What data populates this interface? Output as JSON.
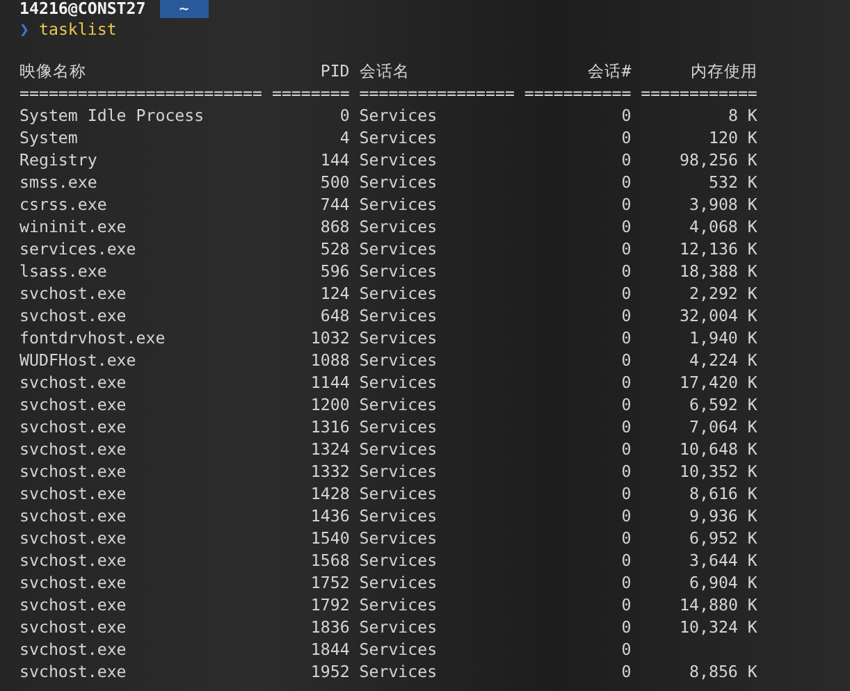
{
  "prompt": {
    "user_host": "14216@CONST27",
    "path": "~",
    "symbol": "❯",
    "command": "tasklist"
  },
  "table": {
    "columns": [
      "映像名称",
      "PID",
      "会话名",
      "会话#",
      "内存使用"
    ],
    "separators": [
      "=========================",
      "========",
      "================",
      "===========",
      "============"
    ],
    "rows": [
      [
        "System Idle Process",
        "0",
        "Services",
        "0",
        "8 K"
      ],
      [
        "System",
        "4",
        "Services",
        "0",
        "120 K"
      ],
      [
        "Registry",
        "144",
        "Services",
        "0",
        "98,256 K"
      ],
      [
        "smss.exe",
        "500",
        "Services",
        "0",
        "532 K"
      ],
      [
        "csrss.exe",
        "744",
        "Services",
        "0",
        "3,908 K"
      ],
      [
        "wininit.exe",
        "868",
        "Services",
        "0",
        "4,068 K"
      ],
      [
        "services.exe",
        "528",
        "Services",
        "0",
        "12,136 K"
      ],
      [
        "lsass.exe",
        "596",
        "Services",
        "0",
        "18,388 K"
      ],
      [
        "svchost.exe",
        "124",
        "Services",
        "0",
        "2,292 K"
      ],
      [
        "svchost.exe",
        "648",
        "Services",
        "0",
        "32,004 K"
      ],
      [
        "fontdrvhost.exe",
        "1032",
        "Services",
        "0",
        "1,940 K"
      ],
      [
        "WUDFHost.exe",
        "1088",
        "Services",
        "0",
        "4,224 K"
      ],
      [
        "svchost.exe",
        "1144",
        "Services",
        "0",
        "17,420 K"
      ],
      [
        "svchost.exe",
        "1200",
        "Services",
        "0",
        "6,592 K"
      ],
      [
        "svchost.exe",
        "1316",
        "Services",
        "0",
        "7,064 K"
      ],
      [
        "svchost.exe",
        "1324",
        "Services",
        "0",
        "10,648 K"
      ],
      [
        "svchost.exe",
        "1332",
        "Services",
        "0",
        "10,352 K"
      ],
      [
        "svchost.exe",
        "1428",
        "Services",
        "0",
        "8,616 K"
      ],
      [
        "svchost.exe",
        "1436",
        "Services",
        "0",
        "9,936 K"
      ],
      [
        "svchost.exe",
        "1540",
        "Services",
        "0",
        "6,952 K"
      ],
      [
        "svchost.exe",
        "1568",
        "Services",
        "0",
        "3,644 K"
      ],
      [
        "svchost.exe",
        "1752",
        "Services",
        "0",
        "6,904 K"
      ],
      [
        "svchost.exe",
        "1792",
        "Services",
        "0",
        "14,880 K"
      ],
      [
        "svchost.exe",
        "1836",
        "Services",
        "0",
        "10,324 K"
      ],
      [
        "svchost.exe",
        "1844",
        "Services",
        "0"
      ],
      [
        "svchost.exe",
        "1952",
        "Services",
        "0",
        "8,856 K"
      ]
    ]
  }
}
